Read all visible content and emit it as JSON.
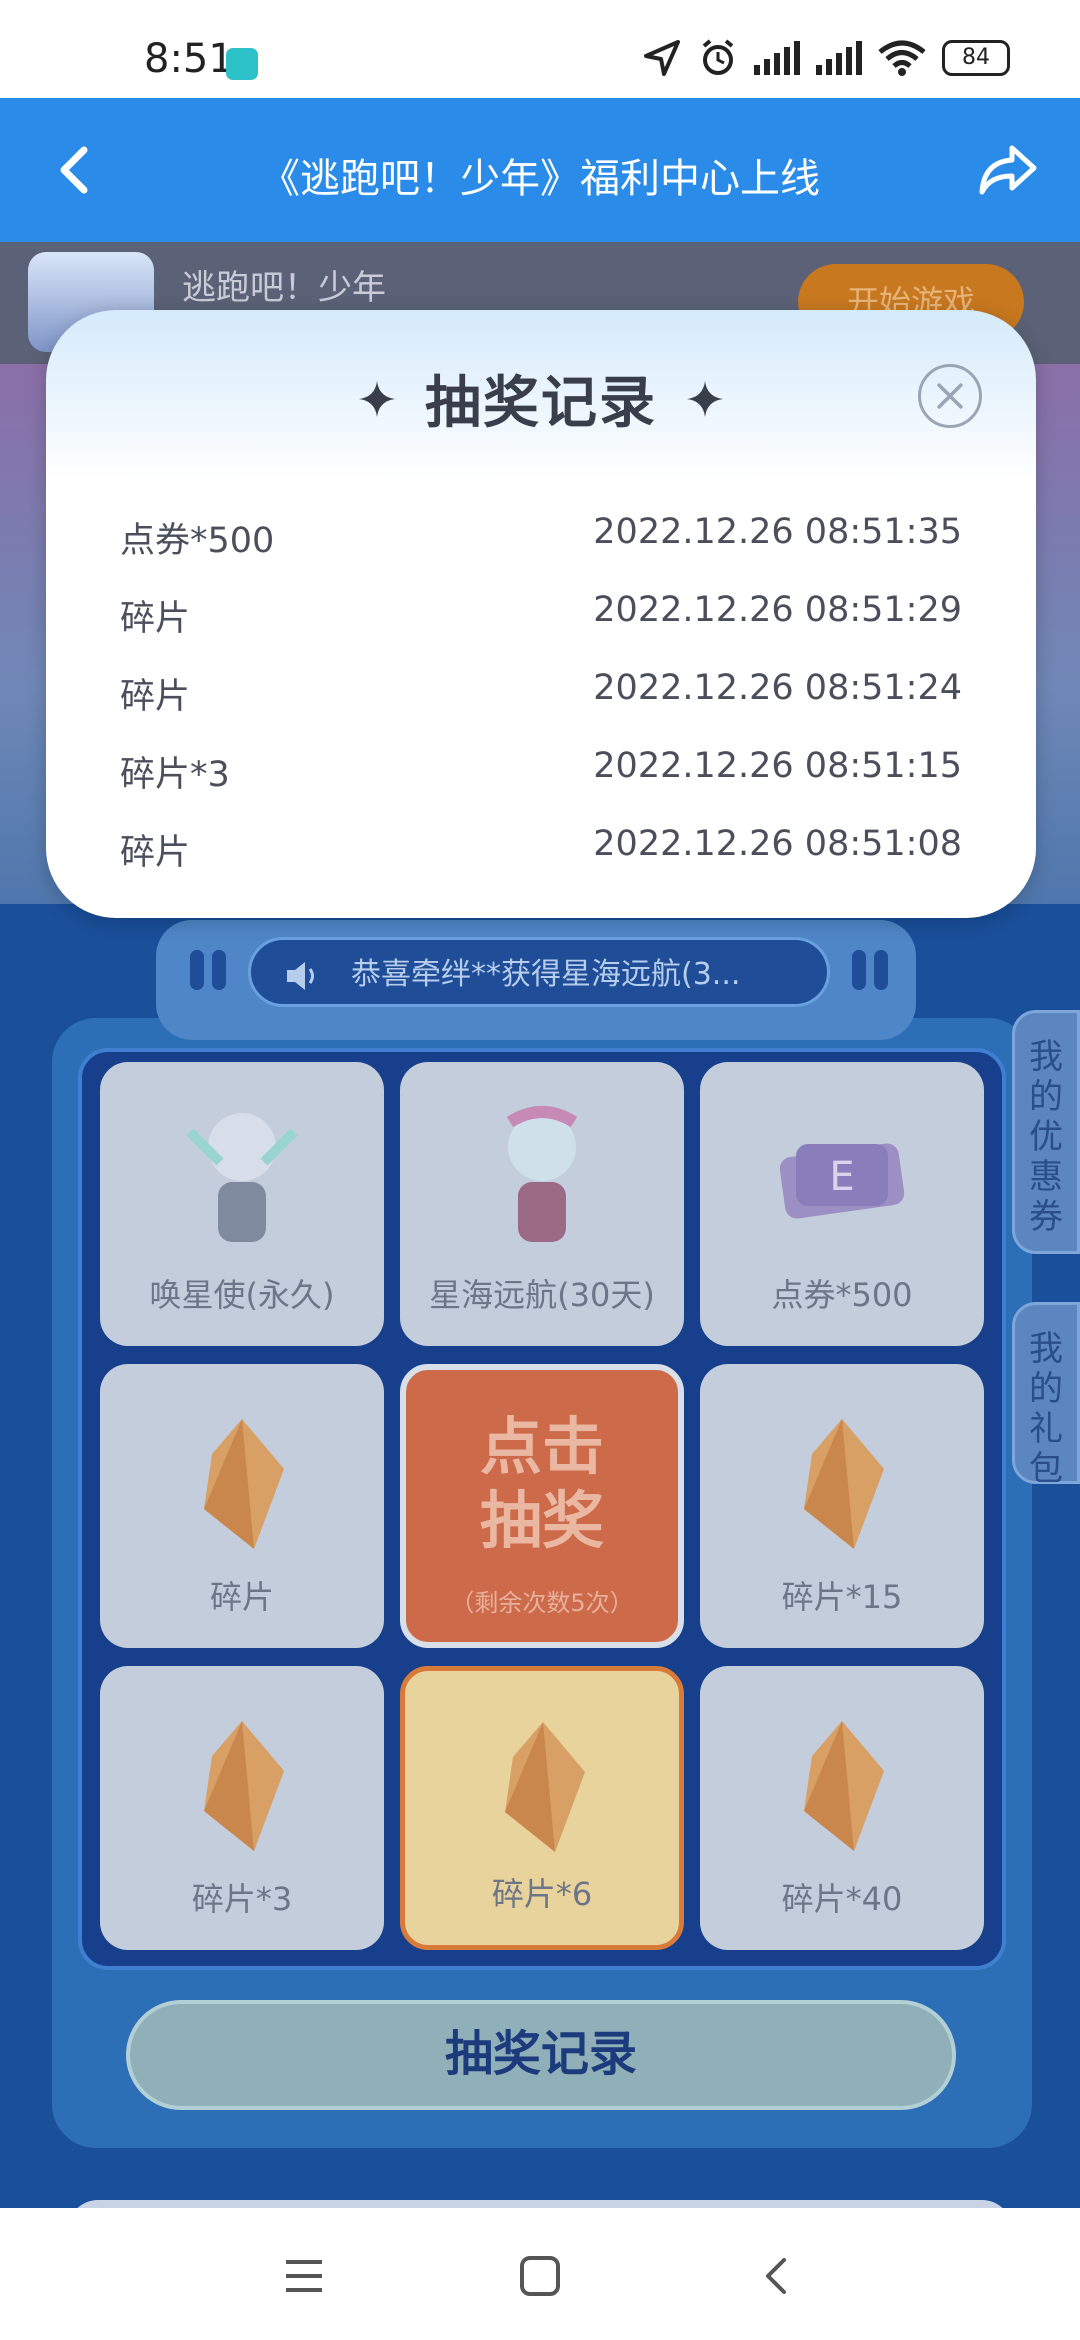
{
  "status_bar": {
    "time": "8:51",
    "battery": "84",
    "icons": [
      "location-icon",
      "alarm-icon",
      "signal-icon",
      "signal-icon",
      "wifi-icon",
      "battery-icon"
    ]
  },
  "header": {
    "title": "《逃跑吧！少年》福利中心上线",
    "back_icon": "chevron-left-icon",
    "share_icon": "share-icon"
  },
  "game": {
    "name": "逃跑吧！少年",
    "start_label": "开始游戏"
  },
  "marquee": {
    "text": "恭喜牵绊**获得星海远航(3..."
  },
  "prizes": [
    {
      "label": "唤星使(永久)"
    },
    {
      "label": "星海远航(30天)"
    },
    {
      "label": "点券*500"
    },
    {
      "label": "碎片"
    },
    {
      "label": "碎片*15"
    },
    {
      "label": "碎片*3"
    },
    {
      "label": "碎片*6"
    },
    {
      "label": "碎片*40"
    }
  ],
  "draw_button": {
    "line1": "点击",
    "line2": "抽奖",
    "remaining": "（剩余次数5次）"
  },
  "side_tabs": {
    "coupons": "我的优惠券",
    "gifts": "我的礼包"
  },
  "records_button": "抽奖记录",
  "modal": {
    "title": "抽奖记录",
    "records": [
      {
        "prize": "点券*500",
        "time": "2022.12.26 08:51:35"
      },
      {
        "prize": "碎片",
        "time": "2022.12.26 08:51:29"
      },
      {
        "prize": "碎片",
        "time": "2022.12.26 08:51:24"
      },
      {
        "prize": "碎片*3",
        "time": "2022.12.26 08:51:15"
      },
      {
        "prize": "碎片",
        "time": "2022.12.26 08:51:08"
      }
    ]
  },
  "colors": {
    "header": "#2a8ce8",
    "panel": "#2d6fb6",
    "draw": "#cd6a4a"
  }
}
